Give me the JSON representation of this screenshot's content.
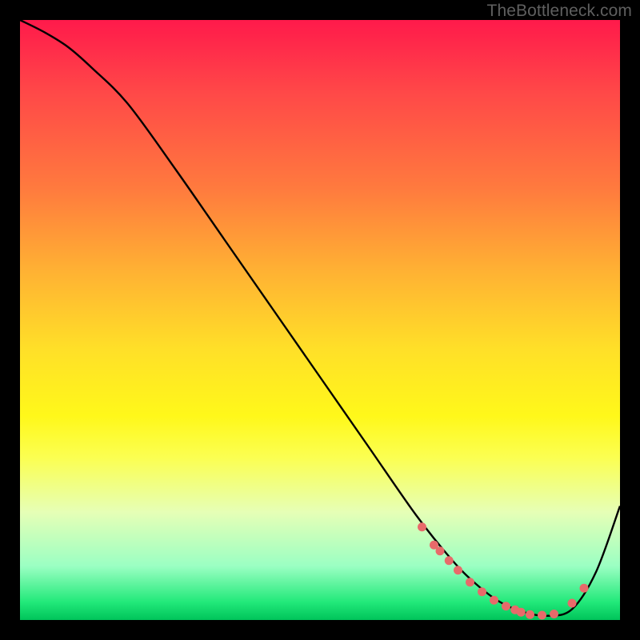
{
  "attribution": "TheBottleneck.com",
  "chart_data": {
    "type": "line",
    "title": "",
    "xlabel": "",
    "ylabel": "",
    "xlim": [
      0,
      100
    ],
    "ylim": [
      0,
      100
    ],
    "series": [
      {
        "name": "curve",
        "x": [
          0,
          4,
          8,
          12,
          18,
          26,
          34,
          42,
          50,
          58,
          66,
          72,
          76,
          80,
          84,
          88,
          92,
          96,
          100
        ],
        "y": [
          100,
          98,
          95.5,
          92,
          86,
          75,
          63.5,
          52,
          40.5,
          29,
          17.5,
          10,
          6,
          3,
          1.3,
          0.7,
          1.8,
          8,
          19
        ]
      }
    ],
    "markers": {
      "name": "highlight-dots",
      "color": "#e86a6a",
      "x": [
        67,
        69,
        70,
        71.5,
        73,
        75,
        77,
        79,
        81,
        82.5,
        83.5,
        85,
        87,
        89,
        92,
        94
      ],
      "y": [
        15.5,
        12.5,
        11.5,
        9.9,
        8.3,
        6.3,
        4.7,
        3.3,
        2.3,
        1.7,
        1.3,
        0.9,
        0.8,
        1.0,
        2.8,
        5.3
      ]
    },
    "colors": {
      "line": "#000000",
      "marker": "#e86a6a",
      "gradient_top": "#ff1a4b",
      "gradient_bottom": "#00c45a"
    }
  }
}
